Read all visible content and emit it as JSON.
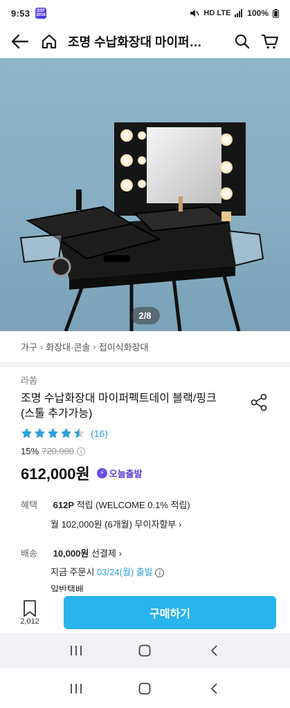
{
  "status_bar": {
    "time": "9:53",
    "app_icon_text": "SSF 2018",
    "network": "HD LTE",
    "battery": "100%"
  },
  "header": {
    "title": "조명 수납화장대 마이퍼…"
  },
  "gallery": {
    "counter": "2/8"
  },
  "breadcrumb": [
    "가구",
    "화장대·콘솔",
    "접이식화장대"
  ],
  "product": {
    "brand": "라쏨",
    "name": "조명 수납화장대 마이퍼펙트데이 블랙/핑크 (스툴 추가가능)",
    "rating": 4.5,
    "review_count": "(16)",
    "discount": "15%",
    "original_price": "720,000",
    "price": "612,000원",
    "delivery_badge": "오늘출발"
  },
  "benefit": {
    "label": "혜택",
    "points": "612P",
    "points_text": "적립 (WELCOME 0.1% 적립)",
    "installment": "월 102,000원 (6개월) 무이자할부"
  },
  "shipping": {
    "label": "배송",
    "fee": "10,000원",
    "fee_text": "선결제",
    "order_prefix": "지금 주문시",
    "date": "03/24(월) 출발",
    "method": "일반택배"
  },
  "bottom": {
    "wish_count": "2,012",
    "buy_label": "구매하기"
  },
  "colors": {
    "accent": "#28b3ec",
    "rating_star": "#2d9fd8",
    "badge": "#6a4ae8",
    "hero_bg": "#86adc1"
  }
}
